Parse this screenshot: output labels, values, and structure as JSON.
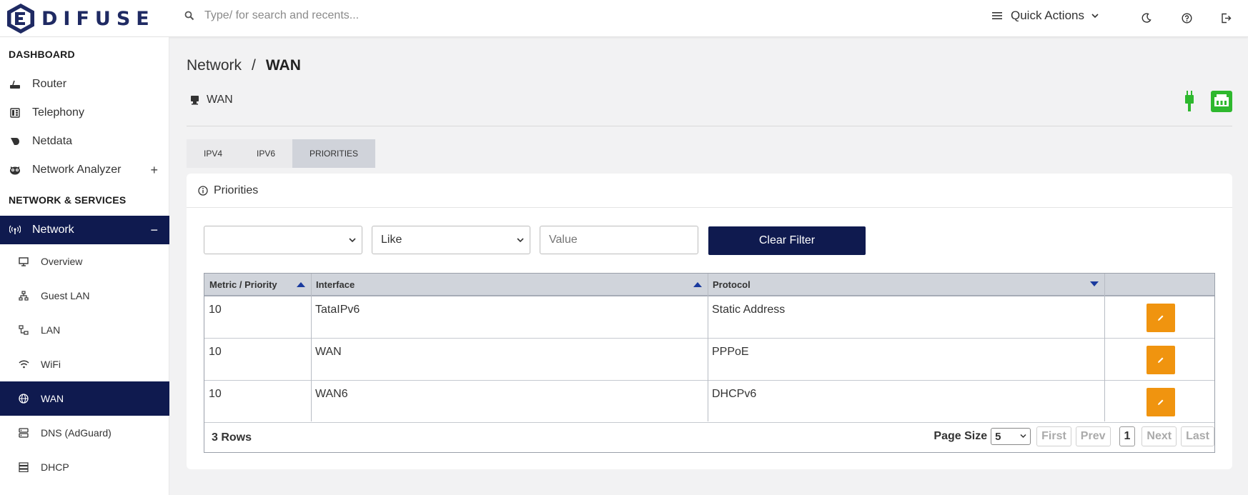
{
  "app": {
    "logo_text": "DIFUSE",
    "search_placeholder": "Type/ for search and recents...",
    "quick_actions_label": "Quick Actions"
  },
  "sidebar": {
    "sections": [
      {
        "title": "DASHBOARD"
      },
      {
        "title": "NETWORK & SERVICES"
      }
    ],
    "items": [
      {
        "label": "Router",
        "icon": "router-icon"
      },
      {
        "label": "Telephony",
        "icon": "telephony-icon"
      },
      {
        "label": "Netdata",
        "icon": "netdata-icon"
      },
      {
        "label": "Network Analyzer",
        "icon": "owl-icon",
        "expander": "+"
      },
      {
        "label": "Network",
        "icon": "antenna-icon",
        "expander": "−"
      }
    ],
    "subitems": [
      {
        "label": "Overview",
        "icon": "monitor-icon"
      },
      {
        "label": "Guest LAN",
        "icon": "guest-lan-icon"
      },
      {
        "label": "LAN",
        "icon": "lan-icon"
      },
      {
        "label": "WiFi",
        "icon": "wifi-icon"
      },
      {
        "label": "WAN",
        "icon": "globe-icon"
      },
      {
        "label": "DNS (AdGuard)",
        "icon": "dns-icon"
      },
      {
        "label": "DHCP",
        "icon": "dhcp-icon"
      }
    ]
  },
  "breadcrumb": {
    "parent": "Network",
    "separator": "/",
    "current": "WAN"
  },
  "page": {
    "subtitle": "WAN"
  },
  "tabs": [
    {
      "label": "IPV4",
      "active": false
    },
    {
      "label": "IPV6",
      "active": false
    },
    {
      "label": "PRIORITIES",
      "active": true
    }
  ],
  "panel": {
    "title": "Priorities"
  },
  "filter": {
    "field_value": "",
    "operator_value": "Like",
    "value_placeholder": "Value",
    "clear_label": "Clear Filter"
  },
  "grid": {
    "columns": [
      "Metric / Priority",
      "Interface",
      "Protocol"
    ],
    "rows": [
      {
        "metric": "10",
        "interface": "TataIPv6",
        "protocol": "Static Address"
      },
      {
        "metric": "10",
        "interface": "WAN",
        "protocol": "PPPoE"
      },
      {
        "metric": "10",
        "interface": "WAN6",
        "protocol": "DHCPv6"
      }
    ],
    "row_count": "3 Rows",
    "page_size_label": "Page Size",
    "page_size": "5",
    "first": "First",
    "prev": "Prev",
    "page": "1",
    "next": "Next",
    "last": "Last"
  },
  "colors": {
    "primary": "#0f1a4f",
    "edit": "#f0940f",
    "status_green": "#2eb82e"
  }
}
